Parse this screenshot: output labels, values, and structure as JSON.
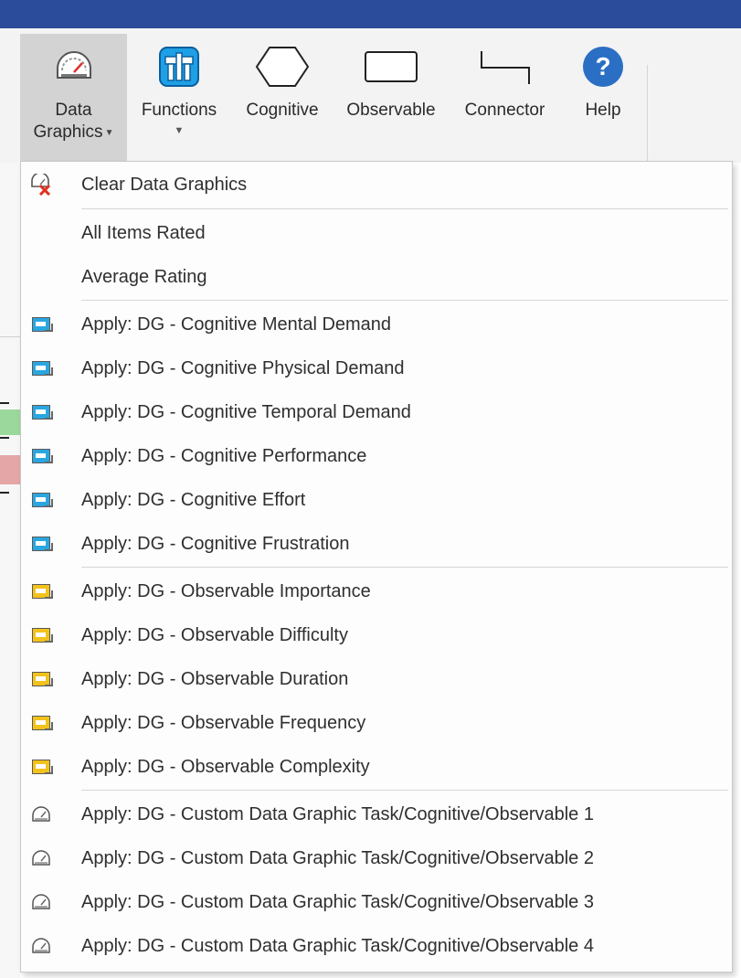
{
  "ribbon": {
    "buttons": [
      {
        "label_line1": "Data",
        "label_line2": "Graphics",
        "icon": "gauge-icon",
        "has_dropdown": true
      },
      {
        "label_line1": "Functions",
        "icon": "functions-icon",
        "has_dropdown": true
      },
      {
        "label_line1": "Cognitive",
        "icon": "hexagon-icon"
      },
      {
        "label_line1": "Observable",
        "icon": "rectangle-icon"
      },
      {
        "label_line1": "Connector",
        "icon": "connector-icon"
      },
      {
        "label_line1": "Help",
        "icon": "help-icon"
      }
    ]
  },
  "menu": {
    "items": [
      {
        "label": "Clear Data Graphics",
        "icon": "clear-data-graphics-icon"
      },
      {
        "label": "All Items Rated",
        "icon": null
      },
      {
        "label": "Average Rating",
        "icon": null
      },
      {
        "label": "Apply: DG - Cognitive Mental Demand",
        "icon": "blue-data-graphic-icon"
      },
      {
        "label": "Apply: DG - Cognitive Physical Demand",
        "icon": "blue-data-graphic-icon"
      },
      {
        "label": "Apply: DG - Cognitive Temporal Demand",
        "icon": "blue-data-graphic-icon"
      },
      {
        "label": "Apply: DG - Cognitive Performance",
        "icon": "blue-data-graphic-icon"
      },
      {
        "label": "Apply: DG - Cognitive Effort",
        "icon": "blue-data-graphic-icon"
      },
      {
        "label": "Apply: DG - Cognitive Frustration",
        "icon": "blue-data-graphic-icon"
      },
      {
        "label": "Apply: DG - Observable Importance",
        "icon": "yellow-data-graphic-icon"
      },
      {
        "label": "Apply: DG - Observable Difficulty",
        "icon": "yellow-data-graphic-icon"
      },
      {
        "label": "Apply: DG - Observable Duration",
        "icon": "yellow-data-graphic-icon"
      },
      {
        "label": "Apply: DG - Observable Frequency",
        "icon": "yellow-data-graphic-icon"
      },
      {
        "label": "Apply: DG - Observable Complexity",
        "icon": "yellow-data-graphic-icon"
      },
      {
        "label": "Apply: DG - Custom Data Graphic Task/Cognitive/Observable 1",
        "icon": "gauge-icon"
      },
      {
        "label": "Apply: DG - Custom Data Graphic Task/Cognitive/Observable 2",
        "icon": "gauge-icon"
      },
      {
        "label": "Apply: DG - Custom Data Graphic Task/Cognitive/Observable 3",
        "icon": "gauge-icon"
      },
      {
        "label": "Apply: DG - Custom Data Graphic Task/Cognitive/Observable 4",
        "icon": "gauge-icon"
      }
    ]
  },
  "colors": {
    "titlebar": "#2b4b9b",
    "functions_icon": "#1ea0e6",
    "help_icon": "#2a6fc4",
    "cognitive_icon": "#2aa6e0",
    "observable_icon": "#f3c21b"
  }
}
